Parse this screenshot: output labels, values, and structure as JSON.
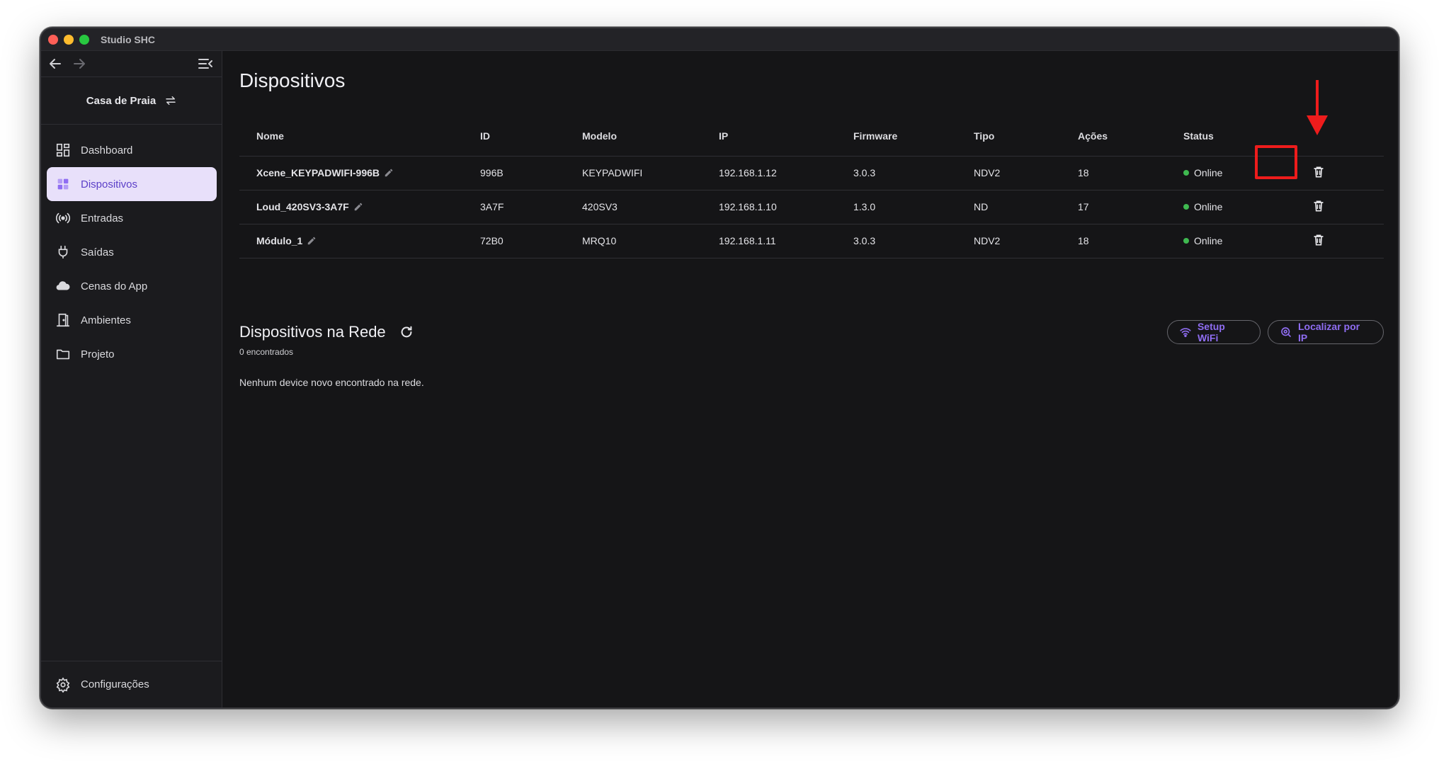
{
  "app": {
    "title": "Studio SHC"
  },
  "sidebar": {
    "house": "Casa de Praia",
    "items": [
      {
        "label": "Dashboard",
        "icon": "dashboard-icon"
      },
      {
        "label": "Dispositivos",
        "icon": "devices-icon"
      },
      {
        "label": "Entradas",
        "icon": "signal-icon"
      },
      {
        "label": "Saídas",
        "icon": "plug-icon"
      },
      {
        "label": "Cenas do App",
        "icon": "cloud-icon"
      },
      {
        "label": "Ambientes",
        "icon": "door-icon"
      },
      {
        "label": "Projeto",
        "icon": "folder-icon"
      }
    ],
    "settings": "Configurações"
  },
  "main": {
    "title": "Dispositivos",
    "table": {
      "headers": [
        "Nome",
        "ID",
        "Modelo",
        "IP",
        "Firmware",
        "Tipo",
        "Ações",
        "Status"
      ],
      "rows": [
        {
          "name": "Xcene_KEYPADWIFI-996B",
          "id": "996B",
          "model": "KEYPADWIFI",
          "ip": "192.168.1.12",
          "firmware": "3.0.3",
          "type": "NDV2",
          "actions": "18",
          "status": "Online"
        },
        {
          "name": "Loud_420SV3-3A7F",
          "id": "3A7F",
          "model": "420SV3",
          "ip": "192.168.1.10",
          "firmware": "1.3.0",
          "type": "ND",
          "actions": "17",
          "status": "Online"
        },
        {
          "name": "Módulo_1",
          "id": "72B0",
          "model": "MRQ10",
          "ip": "192.168.1.11",
          "firmware": "3.0.3",
          "type": "NDV2",
          "actions": "18",
          "status": "Online"
        }
      ]
    },
    "network": {
      "title": "Dispositivos na Rede",
      "count": "0 encontrados",
      "empty": "Nenhum device novo encontrado na rede.",
      "setup_wifi": "Setup WiFi",
      "find_ip": "Localizar por IP"
    }
  },
  "colors": {
    "accent": "#8f6df2",
    "active_bg": "#e8e0fa",
    "online": "#3fb950",
    "annotation": "#ee1c1c"
  }
}
